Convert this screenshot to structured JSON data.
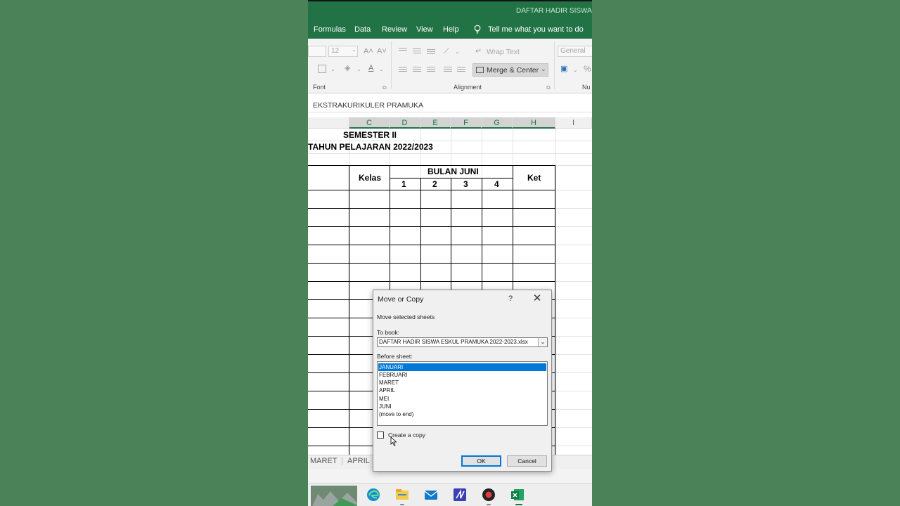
{
  "app": {
    "window_title": "DAFTAR HADIR SISWA ES"
  },
  "menu": {
    "tabs": [
      "Formulas",
      "Data",
      "Review",
      "View",
      "Help"
    ],
    "tell_me": "Tell me what you want to do"
  },
  "ribbon": {
    "font_size": "12",
    "grow_font": "A˄",
    "shrink_font": "A˅",
    "wrap_text": "Wrap Text",
    "merge_center": "Merge & Center",
    "number_format": "General",
    "percent": "%",
    "group_font": "Font",
    "group_alignment": "Alignment",
    "group_number": "Nu"
  },
  "formula_bar": {
    "value": "EKSTRAKURIKULER PRAMUKA"
  },
  "columns": [
    "C",
    "D",
    "E",
    "F",
    "G",
    "H",
    "I"
  ],
  "sheet": {
    "semester": "SEMESTER II",
    "tahun": "TAHUN PELAJARAN 2022/2023",
    "kelas": "Kelas",
    "bulan": "BULAN JUNI",
    "weeks": [
      "1",
      "2",
      "3",
      "4"
    ],
    "ket": "Ket"
  },
  "sheet_tabs": [
    "MARET",
    "APRIL"
  ],
  "dialog": {
    "title": "Move or Copy",
    "help": "?",
    "close": "✕",
    "move_selected": "Move selected sheets",
    "to_book_label": "To book:",
    "to_book_value": "DAFTAR HADIR SISWA ESKUL PRAMUKA 2022-2023.xlsx",
    "before_sheet_label": "Before sheet:",
    "sheets": [
      "JANUARI",
      "FEBRUARI",
      "MARET",
      "APRIL",
      "MEI",
      "JUNI",
      "(move to end)"
    ],
    "selected_sheet": "JANUARI",
    "create_copy": "Create a copy",
    "create_copy_checked": false,
    "ok": "OK",
    "cancel": "Cancel"
  },
  "taskbar": {
    "apps": [
      "edge-icon",
      "file-explorer-icon",
      "mail-icon",
      "app-icon",
      "recorder-icon",
      "excel-icon"
    ]
  },
  "colors": {
    "excel_green": "#217346",
    "background_green": "#4b8257",
    "selection_blue": "#0078d7"
  }
}
